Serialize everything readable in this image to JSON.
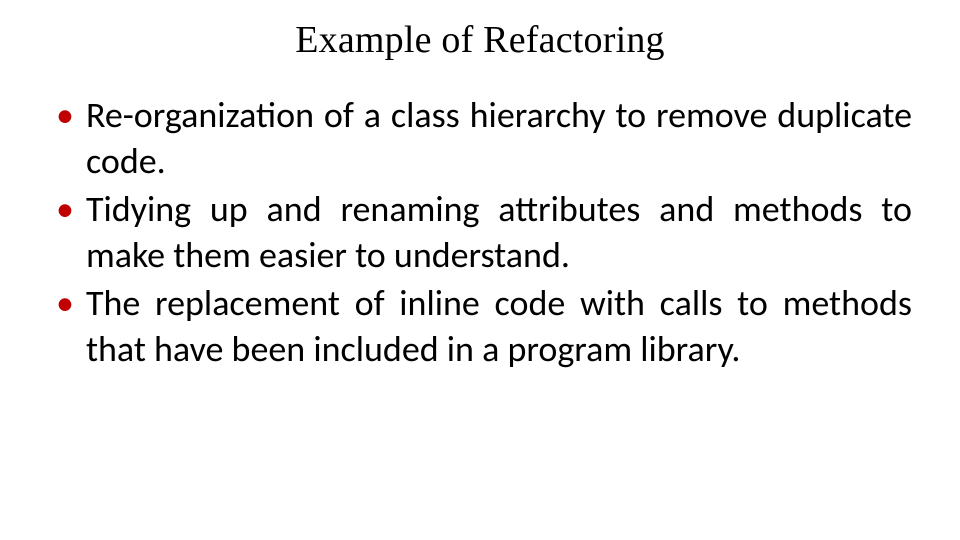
{
  "slide": {
    "title": "Example of Refactoring",
    "bullets": [
      "Re-organization of a class hierarchy to remove duplicate code.",
      "Tidying up and renaming attributes and methods to make them easier to understand.",
      "The replacement of inline code with calls to methods that have been included in a program library."
    ]
  }
}
